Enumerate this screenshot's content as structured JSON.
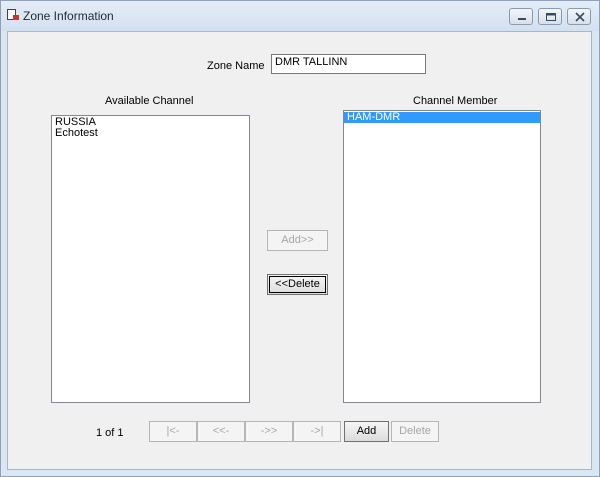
{
  "window": {
    "title": "Zone Information"
  },
  "zone_name": {
    "label": "Zone Name",
    "value": "DMR TALLINN"
  },
  "available": {
    "header": "Available Channel",
    "items": [
      "RUSSIA",
      "Echotest"
    ]
  },
  "members": {
    "header": "Channel Member",
    "items": [
      "HAM-DMR"
    ],
    "selected": "HAM-DMR"
  },
  "buttons": {
    "add_transfer": "Add>>",
    "delete_transfer": "<<Delete",
    "first": "|<-",
    "prev": "<<-",
    "next": "->>",
    "last": "->|",
    "add": "Add",
    "delete": "Delete"
  },
  "pager": {
    "text": "1 of 1"
  }
}
